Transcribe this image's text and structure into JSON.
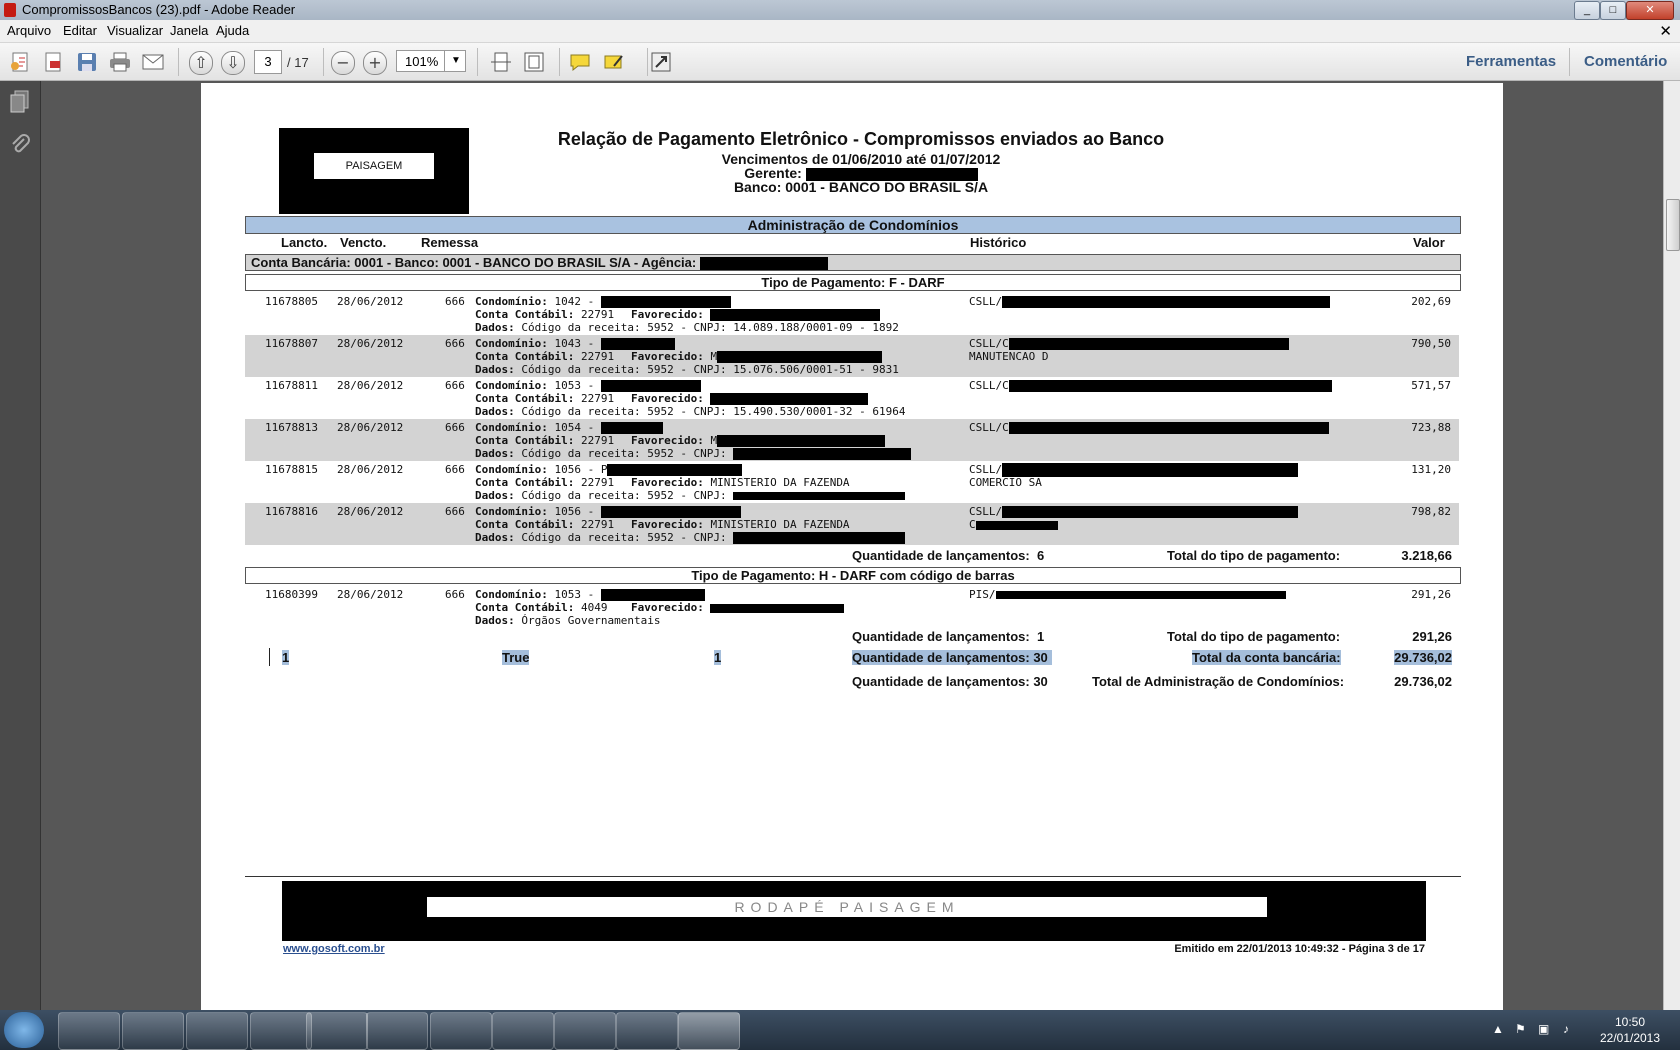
{
  "window": {
    "title": "CompromissosBancos (23).pdf - Adobe Reader"
  },
  "menu": [
    "Arquivo",
    "Editar",
    "Visualizar",
    "Janela",
    "Ajuda"
  ],
  "toolbar": {
    "page_current": "3",
    "page_total": "/ 17",
    "zoom": "101%",
    "tools_label": "Ferramentas",
    "comment_label": "Comentário"
  },
  "report": {
    "logo_text": "PAISAGEM",
    "title": "Relação de Pagamento Eletrônico - Compromissos enviados ao Banco",
    "period": "Vencimentos de 01/06/2010 até 01/07/2012",
    "manager_label": "Gerente:",
    "bank": "Banco: 0001 - BANCO DO BRASIL S/A",
    "section": "Administração de Condomínios",
    "columns": {
      "lancto": "Lancto.",
      "vencto": "Vencto.",
      "remessa": "Remessa",
      "historico": "Histórico",
      "valor": "Valor"
    },
    "account_bar": "Conta Bancária: 0001 - Banco: 0001 - BANCO DO BRASIL S/A - Agência:",
    "group1_title": "Tipo de Pagamento: F - DARF",
    "group1_rows": [
      {
        "lancto": "11678805",
        "vencto": "28/06/2012",
        "remessa": "666",
        "cond": "1042 -",
        "conta": "22791",
        "favorecido": "",
        "dados": "Código da receita: 5952 - CNPJ: 14.089.188/0001-09 - 1892",
        "hist1": "CSLL/",
        "hist2": "",
        "valor": "202,69"
      },
      {
        "lancto": "11678807",
        "vencto": "28/06/2012",
        "remessa": "666",
        "cond": "1043 -",
        "conta": "22791",
        "favorecido": "M",
        "dados": "Código da receita: 5952 - CNPJ: 15.076.506/0001-51 - 9831",
        "hist1": "CSLL/C",
        "hist2": "MANUTENCAO D",
        "valor": "790,50"
      },
      {
        "lancto": "11678811",
        "vencto": "28/06/2012",
        "remessa": "666",
        "cond": "1053 -",
        "conta": "22791",
        "favorecido": "",
        "dados": "Código da receita: 5952 - CNPJ: 15.490.530/0001-32 - 61964",
        "hist1": "CSLL/C",
        "hist2": "",
        "valor": "571,57"
      },
      {
        "lancto": "11678813",
        "vencto": "28/06/2012",
        "remessa": "666",
        "cond": "1054 -",
        "conta": "22791",
        "favorecido": "M",
        "dados": "Código da receita: 5952 - CNPJ:",
        "hist1": "CSLL/C",
        "hist2": "",
        "valor": "723,88"
      },
      {
        "lancto": "11678815",
        "vencto": "28/06/2012",
        "remessa": "666",
        "cond": "1056 - P",
        "conta": "22791",
        "favorecido": "MINISTERIO DA FAZENDA",
        "dados": "Código da receita: 5952 - CNPJ:",
        "hist1": "CSLL/",
        "hist2": "COMERCIO SA",
        "valor": "131,20"
      },
      {
        "lancto": "11678816",
        "vencto": "28/06/2012",
        "remessa": "666",
        "cond": "1056 -",
        "conta": "22791",
        "favorecido": "MINISTERIO DA FAZENDA",
        "dados": "Código da receita: 5952 - CNPJ:",
        "hist1": "CSLL/",
        "hist2": "C",
        "valor": "798,82"
      }
    ],
    "group1_count_label": "Quantidade de lançamentos:",
    "group1_count": "6",
    "group1_total_label": "Total do tipo de pagamento:",
    "group1_total": "3.218,66",
    "group2_title": "Tipo de Pagamento: H - DARF com código de barras",
    "group2_row": {
      "lancto": "11680399",
      "vencto": "28/06/2012",
      "remessa": "666",
      "cond": "1053 -",
      "conta": "4049",
      "favorecido": "",
      "dados": "Órgãos Governamentais",
      "hist1": "PIS/",
      "valor": "291,26"
    },
    "group2_count": "1",
    "group2_total": "291,26",
    "sel_a": "1",
    "sel_b": "True",
    "sel_c": "1",
    "account_count": "30",
    "account_total_label": "Total da conta bancária:",
    "account_total": "29.736,02",
    "admin_count": "30",
    "admin_total_label": "Total de Administração de Condomínios:",
    "admin_total": "29.736,02",
    "labels": {
      "condominio": "Condomínio:",
      "conta": "Conta Contábil:",
      "favorecido": "Favorecido:",
      "dados": "Dados:"
    },
    "footer_logo_text": "RODAPÉ PAISAGEM",
    "footer_link": "www.gosoft.com.br",
    "footer_emitted": "Emitido em 22/01/2013 10:49:32 - Página 3 de 17"
  },
  "taskbar": {
    "time": "10:50",
    "date": "22/01/2013"
  }
}
